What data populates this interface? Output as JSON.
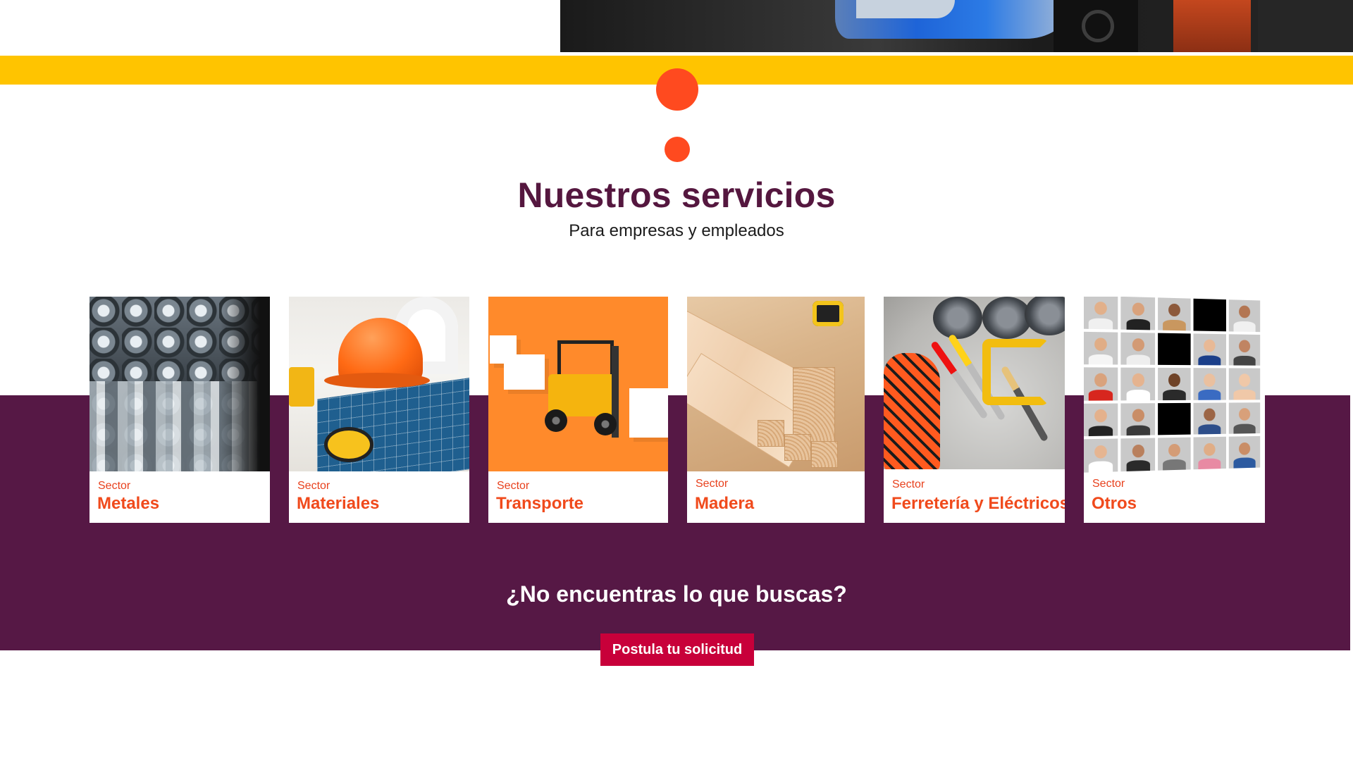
{
  "section": {
    "title": "Nuestros servicios",
    "subtitle": "Para empresas y empleados"
  },
  "sectors": [
    {
      "kicker": "Sector",
      "name": "Metales",
      "image": "metal-tubes"
    },
    {
      "kicker": "Sector",
      "name": "Materiales",
      "image": "helmet-blueprint"
    },
    {
      "kicker": "Sector",
      "name": "Transporte",
      "image": "toy-forklift"
    },
    {
      "kicker": "Sector",
      "name": "Madera",
      "image": "wood-planks"
    },
    {
      "kicker": "Sector",
      "name": "Ferretería y Eléctricos",
      "image": "hand-tools"
    },
    {
      "kicker": "Sector",
      "name": "Otros",
      "image": "people-grid"
    }
  ],
  "cta": {
    "question": "¿No encuentras lo que buscas?",
    "button_label": "Postula tu solicitud"
  },
  "colors": {
    "brand_purple": "#561845",
    "accent_yellow": "#ffc400",
    "accent_orange": "#ff4a1f",
    "button_red": "#c8003a"
  }
}
